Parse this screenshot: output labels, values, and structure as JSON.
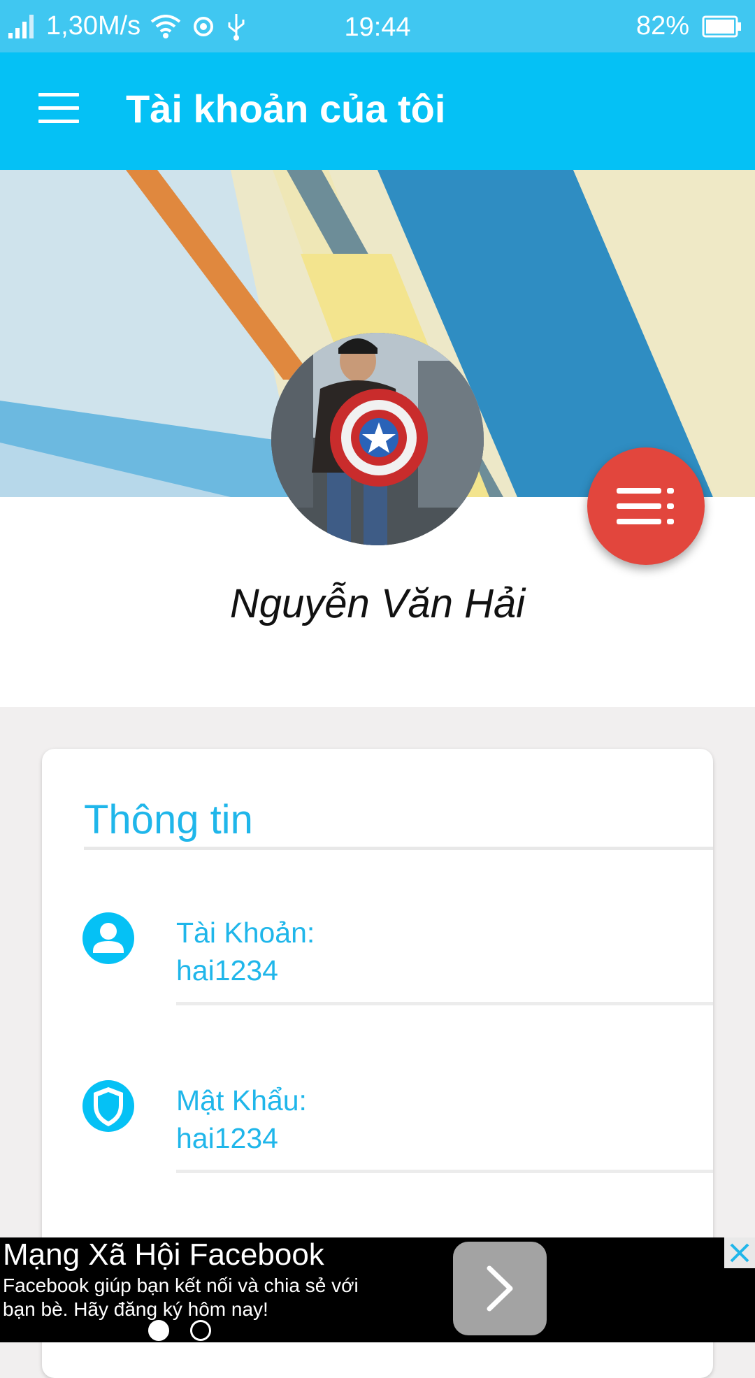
{
  "status_bar": {
    "network_speed": "1,30M/s",
    "time": "19:44",
    "battery": "82%",
    "icons": [
      "signal-icon",
      "wifi-icon",
      "location-icon",
      "usb-icon",
      "battery-icon"
    ]
  },
  "app_bar": {
    "title": "Tài khoản của tôi",
    "menu_icon": "hamburger-menu-icon"
  },
  "profile": {
    "name": "Nguyễn Văn Hải",
    "fab_icon": "list-menu-icon"
  },
  "info_card": {
    "title": "Thông tin",
    "rows": [
      {
        "icon": "account-icon",
        "label": "Tài Khoản:",
        "value": "hai1234"
      },
      {
        "icon": "shield-icon",
        "label": "Mật Khẩu:",
        "value": "hai1234"
      }
    ]
  },
  "ad": {
    "title": "Mạng Xã Hội Facebook",
    "description": "Facebook giúp bạn kết nối và chia sẻ với bạn bè. Hãy đăng ký hôm nay!",
    "cta_icon": "chevron-right-icon",
    "close_icon": "close-icon",
    "page_indicator": {
      "total": 2,
      "current": 1
    }
  },
  "colors": {
    "status_bar": "#40c7f1",
    "app_bar": "#05c1f5",
    "accent": "#1fb6ea",
    "fab": "#e2463d"
  }
}
